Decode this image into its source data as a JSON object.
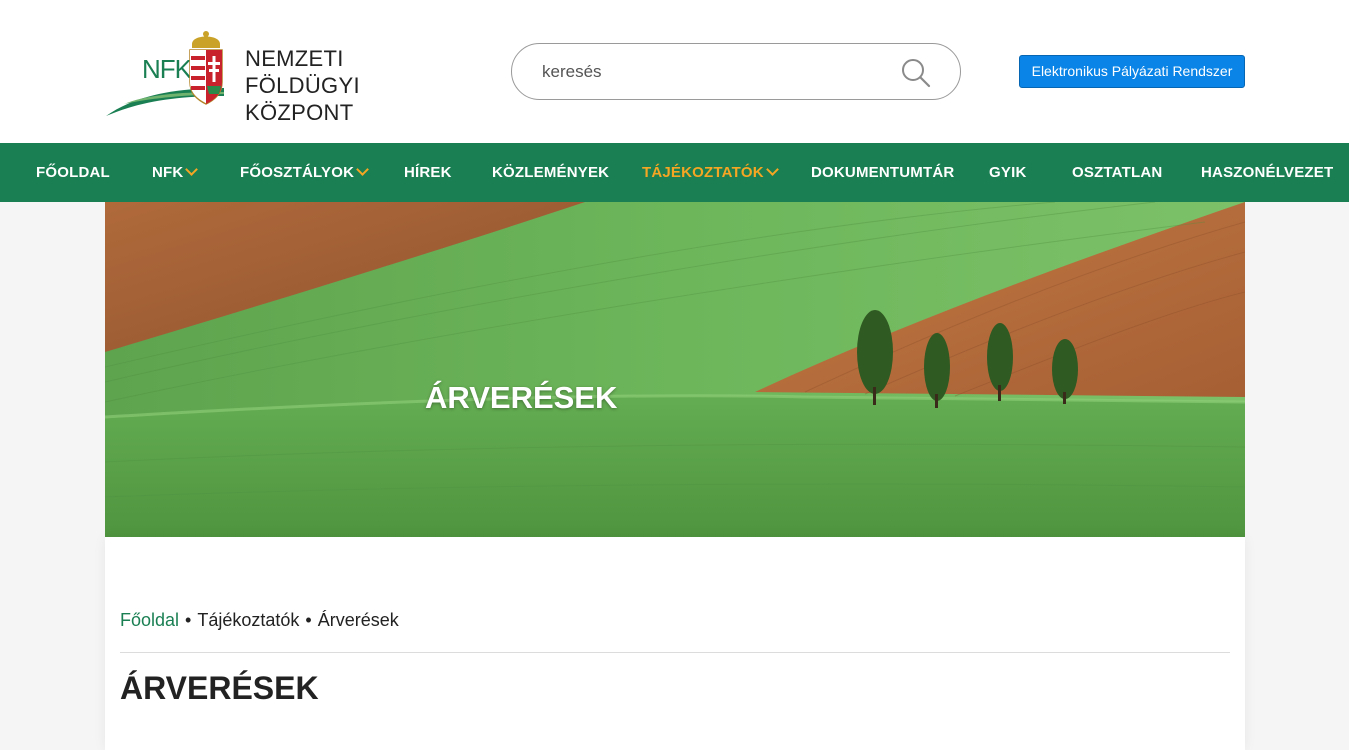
{
  "header": {
    "logo_abbrev": "NFK",
    "logo_line1": "NEMZETI",
    "logo_line2": "FÖLDÜGYI KÖZPONT",
    "search_placeholder": "keresés",
    "search_icon": "search-icon",
    "epr_button": "Elektronikus Pályázati Rendszer"
  },
  "nav": {
    "items": [
      {
        "label": "FŐOLDAL",
        "dropdown": false
      },
      {
        "label": "NFK",
        "dropdown": true
      },
      {
        "label": "FŐOSZTÁLYOK",
        "dropdown": true
      },
      {
        "label": "HÍREK",
        "dropdown": false
      },
      {
        "label": "KÖZLEMÉNYEK",
        "dropdown": false
      },
      {
        "label": "TÁJÉKOZTATÓK",
        "dropdown": true,
        "active": true
      },
      {
        "label": "DOKUMENTUMTÁR",
        "dropdown": false
      },
      {
        "label": "GYIK",
        "dropdown": false
      },
      {
        "label": "OSZTATLAN",
        "dropdown": false
      },
      {
        "label": "HASZONÉLVEZET",
        "dropdown": false
      }
    ]
  },
  "hero": {
    "title": "ÁRVERÉSEK"
  },
  "breadcrumb": {
    "home": "Főoldal",
    "separator": "•",
    "level1": "Tájékoztatók",
    "current": "Árverések"
  },
  "page": {
    "title": "ÁRVERÉSEK"
  },
  "colors": {
    "nav_bg": "#1a7f53",
    "active_nav": "#f5a623",
    "button_blue": "#0a84e6",
    "link_green": "#1a7f53"
  }
}
